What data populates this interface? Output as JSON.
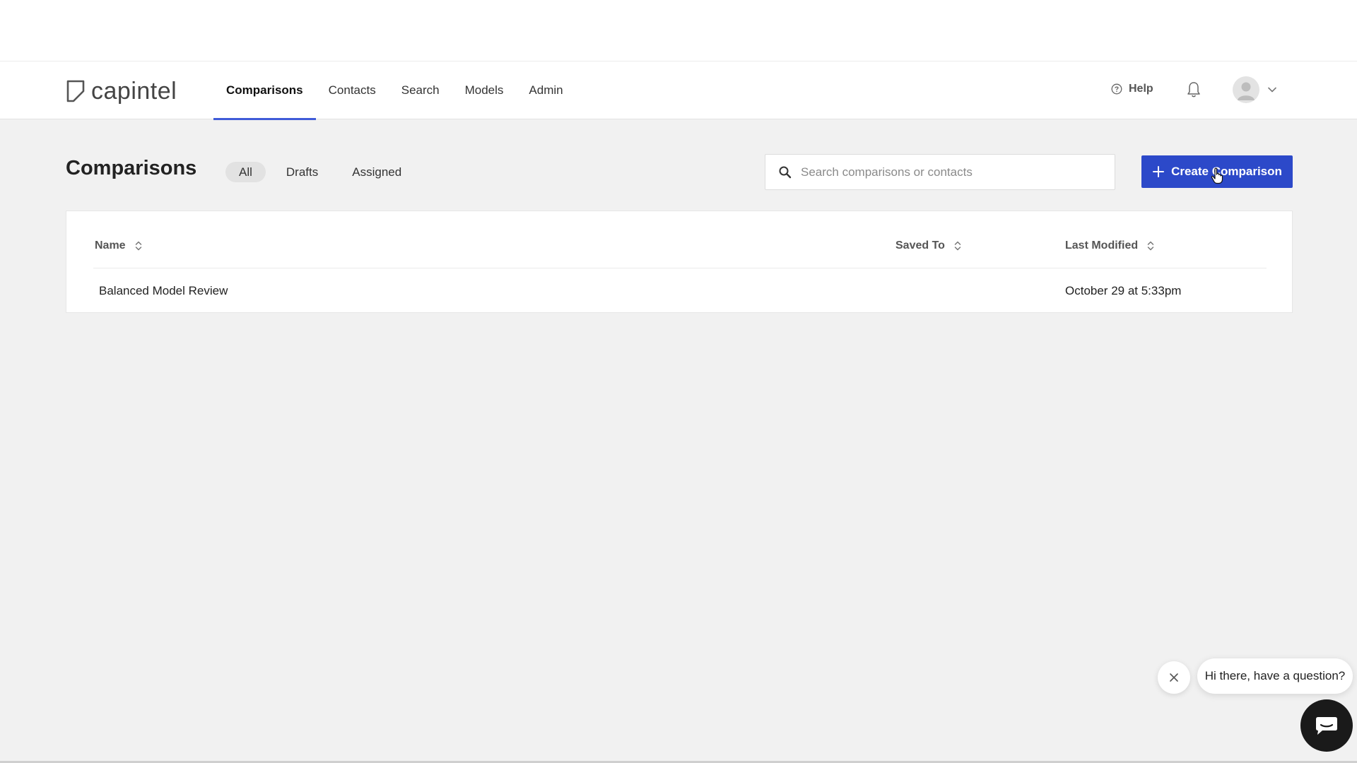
{
  "app": {
    "logo_text": "capintel"
  },
  "nav": {
    "items": [
      {
        "label": "Comparisons",
        "active": true
      },
      {
        "label": "Contacts",
        "active": false
      },
      {
        "label": "Search",
        "active": false
      },
      {
        "label": "Models",
        "active": false
      },
      {
        "label": "Admin",
        "active": false
      }
    ],
    "help_label": "Help"
  },
  "page": {
    "title": "Comparisons",
    "filters": [
      {
        "label": "All",
        "active": true
      },
      {
        "label": "Drafts",
        "active": false
      },
      {
        "label": "Assigned",
        "active": false
      }
    ],
    "search_placeholder": "Search comparisons or contacts",
    "search_value": "",
    "create_button_label": "Create Comparison"
  },
  "table": {
    "columns": [
      "Name",
      "Saved To",
      "Last Modified"
    ],
    "rows": [
      {
        "name": "Balanced Model Review",
        "saved_to": "",
        "last_modified": "October 29 at 5:33pm"
      }
    ]
  },
  "chat": {
    "greeting": "Hi there, have a question?"
  },
  "colors": {
    "accent": "#2c49c9",
    "nav_underline": "#3f5bd8",
    "background": "#f1f1f1"
  },
  "icons": {
    "logo": "capintel-logo-icon",
    "help": "question-circle-icon",
    "notifications": "bell-icon",
    "avatar": "user-avatar-icon",
    "dropdown": "chevron-down-icon",
    "search": "search-icon",
    "create": "plus-icon",
    "sort": "sort-icon",
    "chat_close": "close-icon",
    "chat_launcher": "chat-icon"
  }
}
